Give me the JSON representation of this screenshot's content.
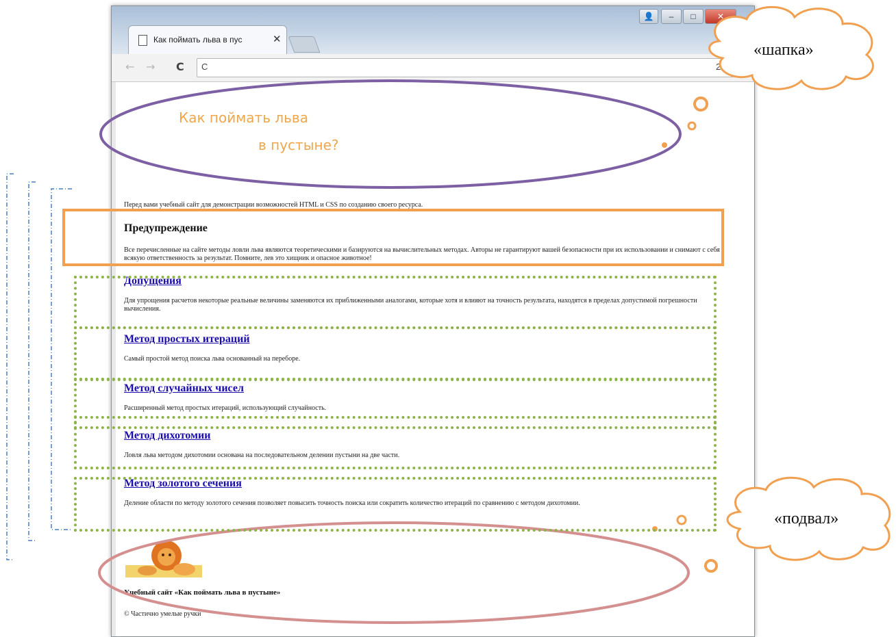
{
  "browser": {
    "tab_title": "Как поймать льва в пус",
    "tab_close": "✕",
    "back_icon": "←",
    "forward_icon": "→",
    "reload_icon": "C",
    "address_partial": "C",
    "omnibox_extra": "2 🔍",
    "window_user": "👤",
    "window_min": "–",
    "window_max": "□",
    "window_close": "✕"
  },
  "logo": {
    "line1": "Как поймать льва",
    "line2": "в пустыне?"
  },
  "intro": "Перед вами учебный сайт для демонстрации возможностей HTML и CSS по созданию своего ресурса.",
  "warning": {
    "title": "Предупреждение",
    "text": "Все перечисленные на сайте методы ловли льва являются теоретическими и базируются на вычислительных методах. Авторы не гарантируют вашей безопасности при их использовании и снимают с себя всякую ответственность за результат. Помните, лев это хищник и опасное животное!"
  },
  "sections": [
    {
      "title": "Допущения",
      "text": "Для упрощения расчетов некоторые реальные величины заменяются их приближенными аналогами, которые хотя и влияют на точность результата, находятся в пределах допустимой погрешности вычисления."
    },
    {
      "title": "Метод простых итераций",
      "text": "Самый простой метод поиска льва основанный на переборе."
    },
    {
      "title": "Метод случайных чисел",
      "text": "Расширенный метод простых итераций, использующий случайность."
    },
    {
      "title": "Метод дихотомии",
      "text": "Ловля льва методом дихотомии основана на последовательном делении пустыни на две части."
    },
    {
      "title": "Метод золотого сечения",
      "text": "Деление области по методу золотого сечения позволяет повысить точность поиска или сократить количество итераций по сравнению с методом дихотомии."
    }
  ],
  "footer": {
    "site_name": "Учебный сайт «Как поймать льва в пустыне»",
    "copyright": "© Частично умелые ручки"
  },
  "annotations": {
    "header_label": "«шапка»",
    "footer_label": "«подвал»",
    "header_ellipse_color": "#7d5fa3",
    "footer_ellipse_color": "#d48f8f",
    "cloud_color": "#f0a050",
    "warning_box_color": "#f0a050",
    "sections_box_color": "#8cb44a",
    "bracket_color": "#4a7fc1"
  }
}
